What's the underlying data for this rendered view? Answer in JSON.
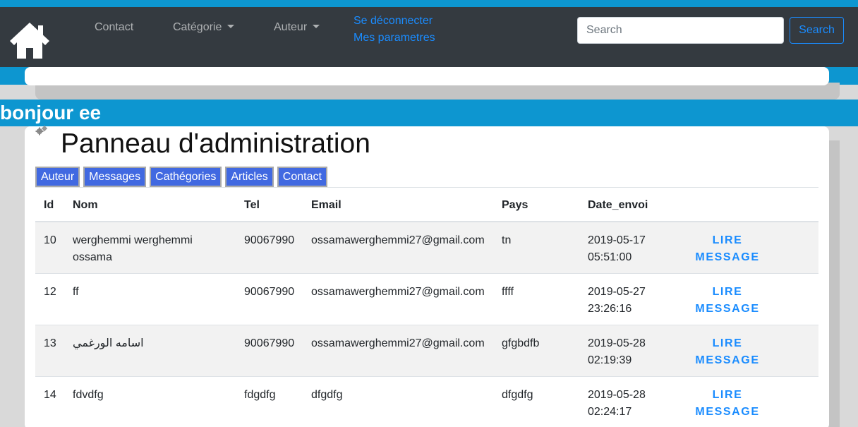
{
  "nav": {
    "links": [
      {
        "label": "Contact"
      },
      {
        "label": "Catégorie"
      },
      {
        "label": "Auteur"
      }
    ],
    "logout_label": "Se déconnecter",
    "settings_label": "Mes parametres",
    "search_placeholder": "Search",
    "search_button": "Search"
  },
  "greeting": "bonjour ee",
  "panel": {
    "title": "Panneau d'administration",
    "tabs": [
      "Auteur",
      "Messages",
      "Cathégories",
      "Articles",
      "Contact"
    ]
  },
  "table": {
    "headers": [
      "Id",
      "Nom",
      "Tel",
      "Email",
      "Pays",
      "Date_envoi"
    ],
    "action_label": "LIRE MESSAGE",
    "rows": [
      {
        "id": "10",
        "nom": "werghemmi werghemmi ossama",
        "tel": "90067990",
        "email": "ossamawerghemmi27@gmail.com",
        "pays": "tn",
        "date": "2019-05-17 05:51:00"
      },
      {
        "id": "12",
        "nom": "ff",
        "tel": "90067990",
        "email": "ossamawerghemmi27@gmail.com",
        "pays": "ffff",
        "date": "2019-05-27 23:26:16"
      },
      {
        "id": "13",
        "nom": "اسامه الورغمي",
        "tel": "90067990",
        "email": "ossamawerghemmi27@gmail.com",
        "pays": "gfgbdfb",
        "date": "2019-05-28 02:19:39"
      },
      {
        "id": "14",
        "nom": "fdvdfg",
        "tel": "fdgdfg",
        "email": "dfgdfg",
        "pays": "dfgdfg",
        "date": "2019-05-28 02:24:17"
      }
    ]
  },
  "colors": {
    "accent": "#0d96d0",
    "navbar": "#343a40",
    "link": "#1a8cff",
    "tab": "#4169e1"
  }
}
